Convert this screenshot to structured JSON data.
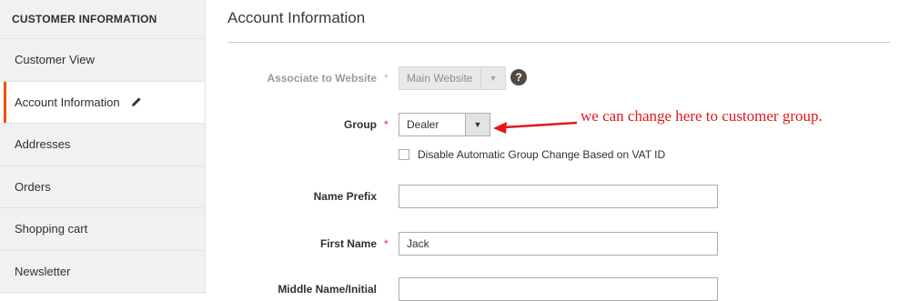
{
  "sidebar": {
    "heading": "CUSTOMER INFORMATION",
    "items": [
      {
        "label": "Customer View"
      },
      {
        "label": "Account Information"
      },
      {
        "label": "Addresses"
      },
      {
        "label": "Orders"
      },
      {
        "label": "Shopping cart"
      },
      {
        "label": "Newsletter"
      }
    ],
    "active_index": 1,
    "active_icon": "pencil-icon"
  },
  "main": {
    "title": "Account Information",
    "fields": {
      "website": {
        "label": "Associate to Website",
        "required_mark": "*",
        "value": "Main Website",
        "help_glyph": "?"
      },
      "group": {
        "label": "Group",
        "required_mark": "*",
        "value": "Dealer"
      },
      "vat_checkbox": {
        "label": "Disable Automatic Group Change Based on VAT ID",
        "checked": false
      },
      "name_prefix": {
        "label": "Name Prefix",
        "value": ""
      },
      "first_name": {
        "label": "First Name",
        "required_mark": "*",
        "value": "Jack"
      },
      "middle_name": {
        "label": "Middle Name/Initial",
        "value": ""
      }
    },
    "annotation": {
      "text": "we can change here to customer group.",
      "color": "#e3171b"
    }
  },
  "colors": {
    "accent": "#eb5202",
    "required": "#e22626"
  }
}
